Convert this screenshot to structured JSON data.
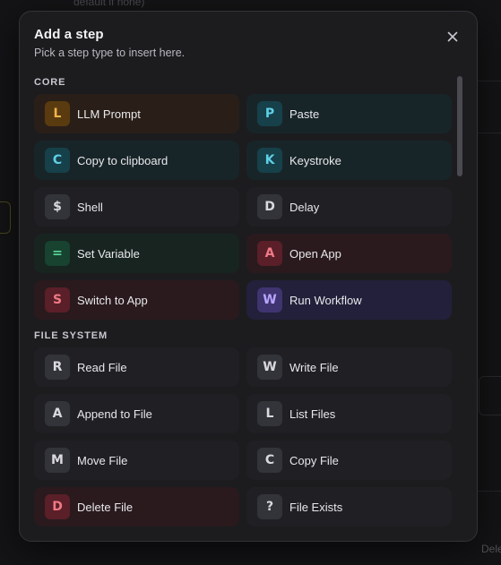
{
  "background": {
    "top_text": "default if none)",
    "bottom_text": "Dele"
  },
  "modal": {
    "title": "Add a step",
    "subtitle": "Pick a step type to insert here.",
    "close_icon": "close-icon"
  },
  "sections": [
    {
      "label": "CORE",
      "items": [
        {
          "badge": "L",
          "label": "LLM Prompt",
          "tone": "orange"
        },
        {
          "badge": "P",
          "label": "Paste",
          "tone": "teal"
        },
        {
          "badge": "C",
          "label": "Copy to clipboard",
          "tone": "teal"
        },
        {
          "badge": "K",
          "label": "Keystroke",
          "tone": "teal"
        },
        {
          "badge": "$",
          "label": "Shell",
          "tone": "neutral"
        },
        {
          "badge": "D",
          "label": "Delay",
          "tone": "neutral"
        },
        {
          "badge": "=",
          "label": "Set Variable",
          "tone": "green"
        },
        {
          "badge": "A",
          "label": "Open App",
          "tone": "red"
        },
        {
          "badge": "S",
          "label": "Switch to App",
          "tone": "red"
        },
        {
          "badge": "W",
          "label": "Run Workflow",
          "tone": "purple"
        }
      ]
    },
    {
      "label": "FILE SYSTEM",
      "items": [
        {
          "badge": "R",
          "label": "Read File",
          "tone": "neutral"
        },
        {
          "badge": "W",
          "label": "Write File",
          "tone": "neutral"
        },
        {
          "badge": "A",
          "label": "Append to File",
          "tone": "neutral"
        },
        {
          "badge": "L",
          "label": "List Files",
          "tone": "neutral"
        },
        {
          "badge": "M",
          "label": "Move File",
          "tone": "neutral"
        },
        {
          "badge": "C",
          "label": "Copy File",
          "tone": "neutral"
        },
        {
          "badge": "D",
          "label": "Delete File",
          "tone": "red"
        },
        {
          "badge": "?",
          "label": "File Exists",
          "tone": "neutral"
        }
      ]
    }
  ]
}
